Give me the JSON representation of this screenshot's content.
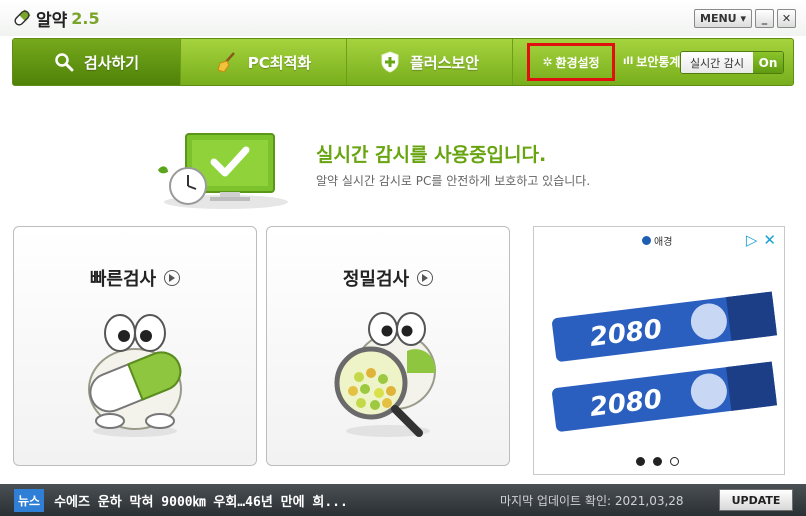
{
  "app": {
    "name": "알약",
    "version": "2.5"
  },
  "window": {
    "menu_label": "MENU ▾",
    "minimize_label": "_",
    "close_label": "✕"
  },
  "nav": {
    "tabs": [
      {
        "label": "검사하기",
        "icon": "search-icon"
      },
      {
        "label": "PC최적화",
        "icon": "broom-icon"
      },
      {
        "label": "플러스보안",
        "icon": "shield-plus-icon"
      }
    ],
    "settings_label": "환경설정",
    "stats_label": "보안통계",
    "realtime_label": "실시간 감시",
    "realtime_state": "On"
  },
  "status": {
    "title": "실시간 감시를 사용중입니다.",
    "subtitle": "알약 실시간 감시로 PC를 안전하게 보호하고 있습니다."
  },
  "scans": [
    {
      "label": "빠른검사"
    },
    {
      "label": "정밀검사"
    }
  ],
  "ad": {
    "brand": "애경",
    "product": "2080"
  },
  "footer": {
    "news_badge": "뉴스",
    "headline": "수에즈 운하 막혀 9000㎞ 우회…46년 만에 희...",
    "last_update": "마지막 업데이트 확인: 2021,03,28",
    "update_button": "UPDATE"
  },
  "colors": {
    "accent": "#78ae1c",
    "highlight_box": "#e01010",
    "news_badge": "#2f7fd6"
  }
}
